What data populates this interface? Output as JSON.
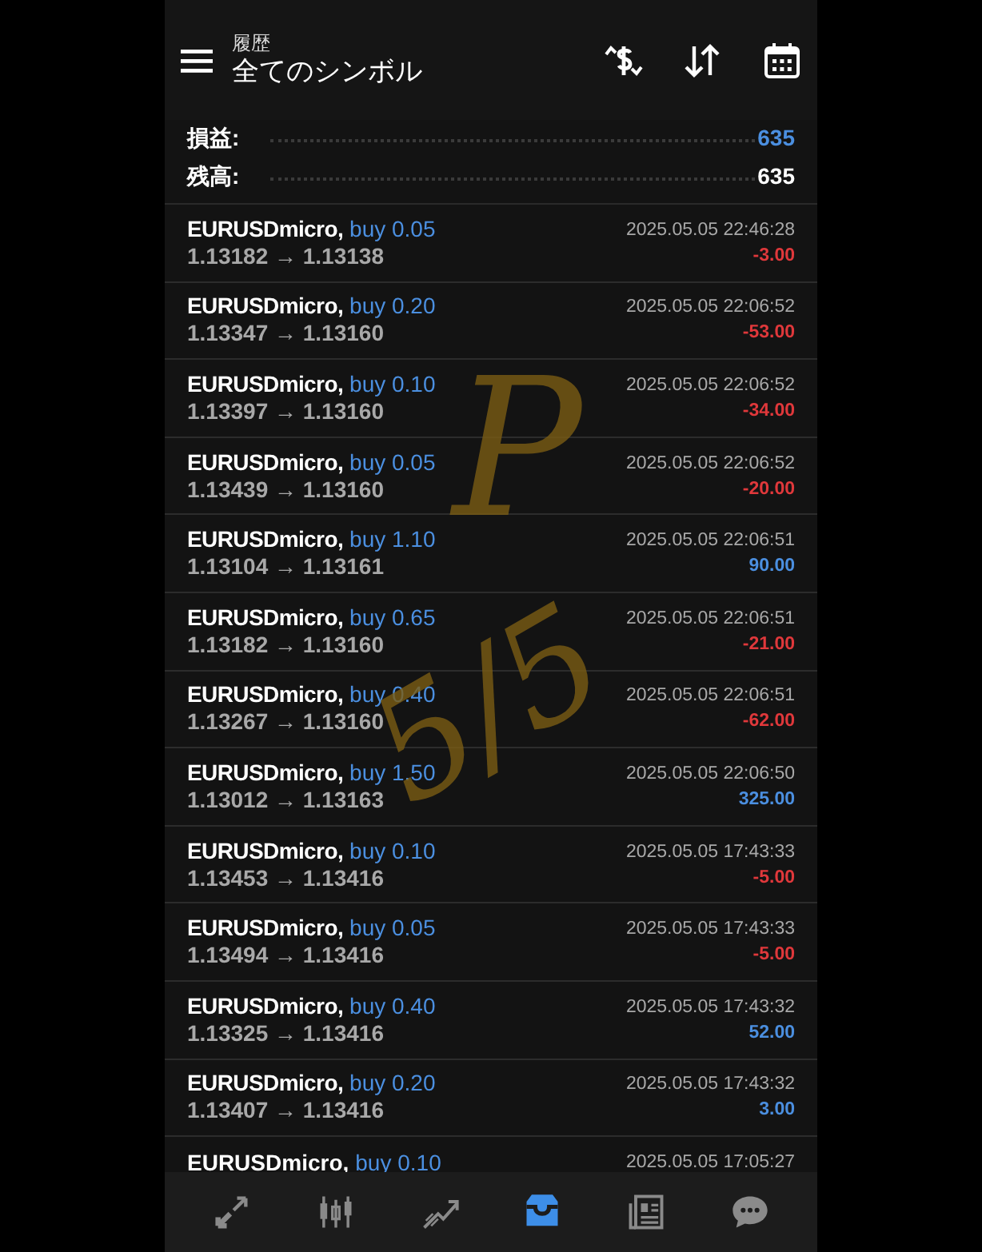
{
  "header": {
    "subtitle": "履歴",
    "title": "全てのシンボル"
  },
  "summary": [
    {
      "label": "損益:",
      "value": "635",
      "kind": "profit"
    },
    {
      "label": "残高:",
      "value": "635",
      "kind": "plain"
    }
  ],
  "deals": [
    {
      "symbol": "EURUSDmicro,",
      "order": "buy 0.05",
      "prices": "1.13182 → 1.13138",
      "time": "2025.05.05 22:46:28",
      "profit": "-3.00",
      "color": "#e0383b"
    },
    {
      "symbol": "EURUSDmicro,",
      "order": "buy 0.20",
      "prices": "1.13347 → 1.13160",
      "time": "2025.05.05 22:06:52",
      "profit": "-53.00",
      "color": "#e0383b"
    },
    {
      "symbol": "EURUSDmicro,",
      "order": "buy 0.10",
      "prices": "1.13397 → 1.13160",
      "time": "2025.05.05 22:06:52",
      "profit": "-34.00",
      "color": "#e0383b"
    },
    {
      "symbol": "EURUSDmicro,",
      "order": "buy 0.05",
      "prices": "1.13439 → 1.13160",
      "time": "2025.05.05 22:06:52",
      "profit": "-20.00",
      "color": "#e0383b"
    },
    {
      "symbol": "EURUSDmicro,",
      "order": "buy 1.10",
      "prices": "1.13104 → 1.13161",
      "time": "2025.05.05 22:06:51",
      "profit": "90.00",
      "color": "#4b8fe0"
    },
    {
      "symbol": "EURUSDmicro,",
      "order": "buy 0.65",
      "prices": "1.13182 → 1.13160",
      "time": "2025.05.05 22:06:51",
      "profit": "-21.00",
      "color": "#e0383b"
    },
    {
      "symbol": "EURUSDmicro,",
      "order": "buy 0.40",
      "prices": "1.13267 → 1.13160",
      "time": "2025.05.05 22:06:51",
      "profit": "-62.00",
      "color": "#e0383b"
    },
    {
      "symbol": "EURUSDmicro,",
      "order": "buy 1.50",
      "prices": "1.13012 → 1.13163",
      "time": "2025.05.05 22:06:50",
      "profit": "325.00",
      "color": "#4b8fe0"
    },
    {
      "symbol": "EURUSDmicro,",
      "order": "buy 0.10",
      "prices": "1.13453 → 1.13416",
      "time": "2025.05.05 17:43:33",
      "profit": "-5.00",
      "color": "#e0383b"
    },
    {
      "symbol": "EURUSDmicro,",
      "order": "buy 0.05",
      "prices": "1.13494 → 1.13416",
      "time": "2025.05.05 17:43:33",
      "profit": "-5.00",
      "color": "#e0383b"
    },
    {
      "symbol": "EURUSDmicro,",
      "order": "buy 0.40",
      "prices": "1.13325 → 1.13416",
      "time": "2025.05.05 17:43:32",
      "profit": "52.00",
      "color": "#4b8fe0"
    },
    {
      "symbol": "EURUSDmicro,",
      "order": "buy 0.20",
      "prices": "1.13407 → 1.13416",
      "time": "2025.05.05 17:43:32",
      "profit": "3.00",
      "color": "#4b8fe0"
    }
  ],
  "cut_deal": {
    "symbol": "EURUSDmicro,",
    "order": "buy 0.10",
    "time": "2025.05.05 17:05:27"
  },
  "annotation": [
    "P",
    "5/5"
  ],
  "nav": [
    {
      "kind": "trade",
      "selected": false
    },
    {
      "kind": "chart",
      "selected": false
    },
    {
      "kind": "trend",
      "selected": false
    },
    {
      "kind": "history",
      "selected": true
    },
    {
      "kind": "news",
      "selected": false
    },
    {
      "kind": "chat",
      "selected": false
    }
  ]
}
